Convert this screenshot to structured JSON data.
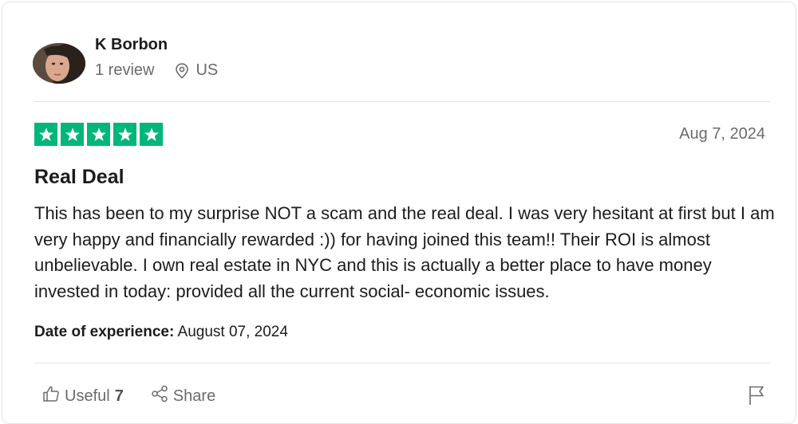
{
  "reviewer": {
    "name": "K Borbon",
    "review_count": "1 review",
    "country": "US"
  },
  "review": {
    "rating": 5,
    "rating_max": 5,
    "date": "Aug 7, 2024",
    "title": "Real Deal",
    "body": "This has been to my surprise NOT a scam and the real deal. I was very hesitant at first but I am very happy and financially rewarded :)) for having joined this team!! Their ROI is almost unbelievable. I own real estate in NYC and this is actually a better place to have money invested in today: provided all the current social- economic issues.",
    "experience_label": "Date of experience:",
    "experience_date": "August 07, 2024"
  },
  "actions": {
    "useful_label": "Useful",
    "useful_count": "7",
    "share_label": "Share"
  },
  "colors": {
    "star_green": "#00b67a",
    "text_dark": "#1c1c1c",
    "text_muted": "#6b6b6b"
  },
  "icons": [
    "location-pin-icon",
    "star-icon",
    "thumbs-up-icon",
    "share-icon",
    "flag-icon"
  ]
}
